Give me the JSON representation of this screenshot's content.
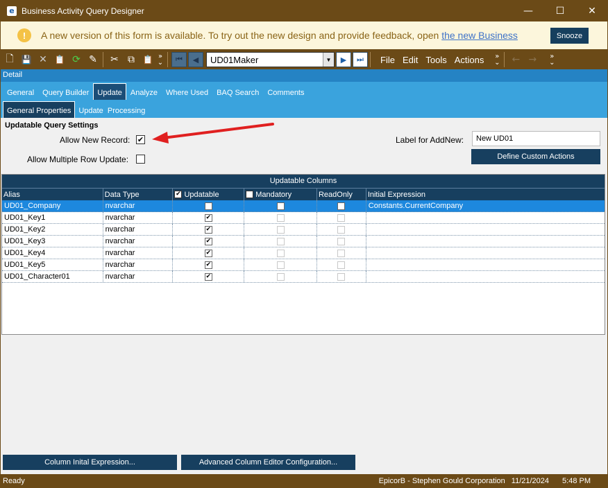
{
  "window": {
    "title": "Business Activity Query Designer",
    "app_icon_glyph": "e",
    "controls": {
      "minimize": "—",
      "maximize": "☐",
      "close": "✕"
    }
  },
  "notification": {
    "text": "A new version of this form is available. To try out the new design and provide feedback, open ",
    "link": "the new Business",
    "icon": "!",
    "snooze_label": "Snooze"
  },
  "toolbar": {
    "icons": [
      "new-icon",
      "save-icon",
      "delete-icon",
      "attach-icon",
      "refresh-icon",
      "clear-icon",
      "cut-icon",
      "copy-icon",
      "paste-icon"
    ],
    "glyphs": {
      "new": "🗋",
      "save": "💾",
      "delete": "✕",
      "attach": "📋",
      "refresh": "⟳",
      "clear": "✎",
      "cut": "✂",
      "copy": "⧉",
      "paste": "📋",
      "first": "⏮",
      "prev": "◀",
      "next": "▶",
      "last": "⏭",
      "back": "←",
      "forward": "→"
    },
    "record_combo_value": "UD01Maker",
    "menus": [
      "File",
      "Edit",
      "Tools",
      "Actions"
    ]
  },
  "detail_band": "Detail",
  "tabs": [
    "General",
    "Query Builder",
    "Update",
    "Analyze",
    "Where Used",
    "BAQ Search",
    "Comments"
  ],
  "active_tab": "Update",
  "subtabs": [
    "General Properties",
    "Update  Processing"
  ],
  "active_subtab": "General Properties",
  "settings": {
    "section_title": "Updatable Query Settings",
    "allow_new_record_label": "Allow New Record:",
    "allow_new_record_checked": true,
    "allow_multiple_label": "Allow Multiple Row Update:",
    "allow_multiple_checked": false,
    "label_for_addnew": "Label for AddNew:",
    "label_for_addnew_value": "New UD01",
    "define_custom_actions": "Define Custom Actions",
    "arrow_color": "#e02020"
  },
  "grid": {
    "caption": "Updatable Columns",
    "headers": [
      "Alias",
      "Data Type",
      "Updatable",
      "Mandatory",
      "ReadOnly",
      "Initial Expression"
    ],
    "header_updatable_checked": true,
    "header_mandatory_checked": false,
    "rows": [
      {
        "alias": "UD01_Company",
        "type": "nvarchar",
        "updatable": "✔",
        "expr": "Constants.CurrentCompany"
      },
      {
        "alias": "UD01_Key1",
        "type": "nvarchar",
        "updatable": "✔",
        "expr": ""
      },
      {
        "alias": "UD01_Key2",
        "type": "nvarchar",
        "updatable": "✔",
        "expr": ""
      },
      {
        "alias": "UD01_Key3",
        "type": "nvarchar",
        "updatable": "✔",
        "expr": ""
      },
      {
        "alias": "UD01_Key4",
        "type": "nvarchar",
        "updatable": "✔",
        "expr": ""
      },
      {
        "alias": "UD01_Key5",
        "type": "nvarchar",
        "updatable": "✔",
        "expr": ""
      },
      {
        "alias": "UD01_Character01",
        "type": "nvarchar",
        "updatable": "✔",
        "expr": ""
      }
    ]
  },
  "bottom_buttons": {
    "column_initial_expression": "Column Inital Expression...",
    "advanced_editor": "Advanced Column Editor Configuration..."
  },
  "status": {
    "left": "Ready",
    "company": "EpicorB - Stephen Gould Corporation",
    "date": "11/21/2024",
    "time": "5:48 PM"
  },
  "colors": {
    "frame": "#6b4a17",
    "tab_band": "#3aa3dd",
    "dark_blue": "#173f5f",
    "selection": "#1d88de"
  }
}
